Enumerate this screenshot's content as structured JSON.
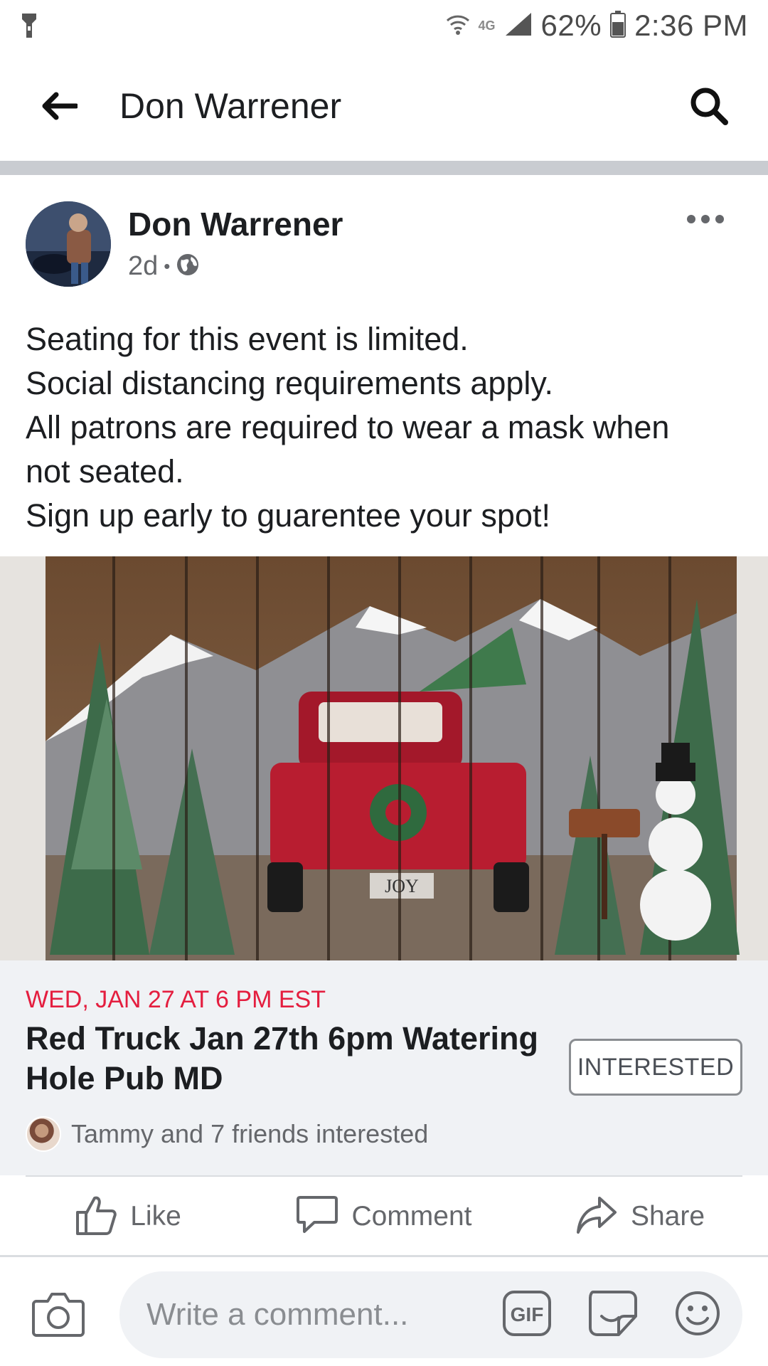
{
  "status_bar": {
    "network": "4G",
    "battery": "62%",
    "time": "2:36 PM",
    "icons": [
      "flashlight-icon",
      "wifi-icon",
      "signal-icon",
      "battery-icon"
    ]
  },
  "header": {
    "title": "Don Warrener",
    "back_icon": "arrow-left-icon",
    "search_icon": "search-icon"
  },
  "post": {
    "author": "Don Warrener",
    "time": "2d",
    "separator": "•",
    "privacy_icon": "globe-icon",
    "more_icon": "more-horizontal-icon",
    "text_lines": [
      "Seating for this event is limited.",
      "Social distancing requirements apply.",
      "All patrons are required to wear a mask when",
      "not seated.",
      "Sign up early to guarentee your spot!"
    ]
  },
  "event": {
    "date": "WED, JAN 27 AT 6 PM EST",
    "title": "Red Truck Jan 27th 6pm Watering Hole Pub MD",
    "interested_label": "INTERESTED",
    "friends_text": "Tammy and 7 friends interested"
  },
  "actions": {
    "like": "Like",
    "comment": "Comment",
    "share": "Share"
  },
  "comment_bar": {
    "placeholder": "Write a comment...",
    "gif_label": "GIF"
  },
  "colors": {
    "event_date": "#e41e3f",
    "secondary_text": "#65676b",
    "card_bg": "#f0f2f5",
    "divider": "#c9ccd1"
  }
}
